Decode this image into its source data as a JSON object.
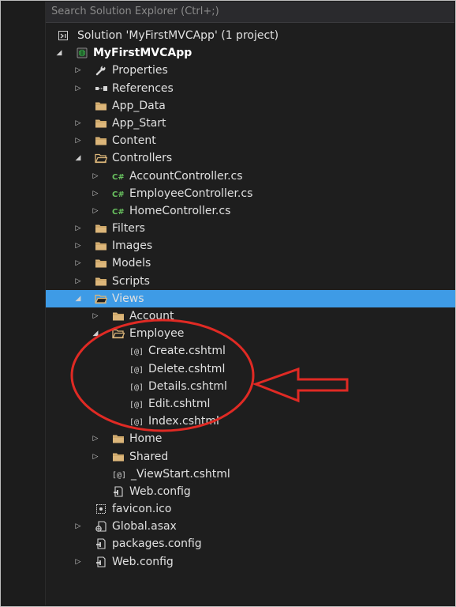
{
  "search": {
    "placeholder": "Search Solution Explorer (Ctrl+;)"
  },
  "tree": {
    "items": [
      {
        "label": "Solution 'MyFirstMVCApp' (1 project)",
        "level": 0,
        "arrow": "none",
        "icon": "solution-icon",
        "bold": false,
        "selected": false
      },
      {
        "label": "MyFirstMVCApp",
        "level": 0,
        "arrow": "expanded",
        "icon": "web-project-icon",
        "bold": true,
        "selected": false
      },
      {
        "label": "Properties",
        "level": 1,
        "arrow": "collapsed",
        "icon": "wrench-icon",
        "bold": false,
        "selected": false
      },
      {
        "label": "References",
        "level": 1,
        "arrow": "collapsed",
        "icon": "references-icon",
        "bold": false,
        "selected": false
      },
      {
        "label": "App_Data",
        "level": 1,
        "arrow": "none",
        "icon": "folder-icon",
        "bold": false,
        "selected": false
      },
      {
        "label": "App_Start",
        "level": 1,
        "arrow": "collapsed",
        "icon": "folder-icon",
        "bold": false,
        "selected": false
      },
      {
        "label": "Content",
        "level": 1,
        "arrow": "collapsed",
        "icon": "folder-icon",
        "bold": false,
        "selected": false
      },
      {
        "label": "Controllers",
        "level": 1,
        "arrow": "expanded",
        "icon": "folder-open-icon",
        "bold": false,
        "selected": false
      },
      {
        "label": "AccountController.cs",
        "level": 2,
        "arrow": "collapsed",
        "icon": "csharp-file-icon",
        "bold": false,
        "selected": false
      },
      {
        "label": "EmployeeController.cs",
        "level": 2,
        "arrow": "collapsed",
        "icon": "csharp-file-icon",
        "bold": false,
        "selected": false
      },
      {
        "label": "HomeController.cs",
        "level": 2,
        "arrow": "collapsed",
        "icon": "csharp-file-icon",
        "bold": false,
        "selected": false
      },
      {
        "label": "Filters",
        "level": 1,
        "arrow": "collapsed",
        "icon": "folder-icon",
        "bold": false,
        "selected": false
      },
      {
        "label": "Images",
        "level": 1,
        "arrow": "collapsed",
        "icon": "folder-icon",
        "bold": false,
        "selected": false
      },
      {
        "label": "Models",
        "level": 1,
        "arrow": "collapsed",
        "icon": "folder-icon",
        "bold": false,
        "selected": false
      },
      {
        "label": "Scripts",
        "level": 1,
        "arrow": "collapsed",
        "icon": "folder-icon",
        "bold": false,
        "selected": false
      },
      {
        "label": "Views",
        "level": 1,
        "arrow": "expanded",
        "icon": "folder-open-icon",
        "bold": false,
        "selected": true
      },
      {
        "label": "Account",
        "level": 2,
        "arrow": "collapsed",
        "icon": "folder-icon",
        "bold": false,
        "selected": false
      },
      {
        "label": "Employee",
        "level": 2,
        "arrow": "expanded",
        "icon": "folder-open-icon",
        "bold": false,
        "selected": false
      },
      {
        "label": "Create.cshtml",
        "level": 3,
        "arrow": "none",
        "icon": "razor-file-icon",
        "bold": false,
        "selected": false
      },
      {
        "label": "Delete.cshtml",
        "level": 3,
        "arrow": "none",
        "icon": "razor-file-icon",
        "bold": false,
        "selected": false
      },
      {
        "label": "Details.cshtml",
        "level": 3,
        "arrow": "none",
        "icon": "razor-file-icon",
        "bold": false,
        "selected": false
      },
      {
        "label": "Edit.cshtml",
        "level": 3,
        "arrow": "none",
        "icon": "razor-file-icon",
        "bold": false,
        "selected": false
      },
      {
        "label": "Index.cshtml",
        "level": 3,
        "arrow": "none",
        "icon": "razor-file-icon",
        "bold": false,
        "selected": false
      },
      {
        "label": "Home",
        "level": 2,
        "arrow": "collapsed",
        "icon": "folder-icon",
        "bold": false,
        "selected": false
      },
      {
        "label": "Shared",
        "level": 2,
        "arrow": "collapsed",
        "icon": "folder-icon",
        "bold": false,
        "selected": false
      },
      {
        "label": "_ViewStart.cshtml",
        "level": 2,
        "arrow": "none",
        "icon": "razor-file-icon",
        "bold": false,
        "selected": false
      },
      {
        "label": "Web.config",
        "level": 2,
        "arrow": "none",
        "icon": "config-file-icon",
        "bold": false,
        "selected": false
      },
      {
        "label": "favicon.ico",
        "level": 1,
        "arrow": "none",
        "icon": "image-file-icon",
        "bold": false,
        "selected": false
      },
      {
        "label": "Global.asax",
        "level": 1,
        "arrow": "collapsed",
        "icon": "global-asax-icon",
        "bold": false,
        "selected": false
      },
      {
        "label": "packages.config",
        "level": 1,
        "arrow": "none",
        "icon": "config-file-icon",
        "bold": false,
        "selected": false
      },
      {
        "label": "Web.config",
        "level": 1,
        "arrow": "collapsed",
        "icon": "config-file-icon",
        "bold": false,
        "selected": false
      }
    ]
  },
  "colors": {
    "background": "#1e1e1e",
    "selection": "#3e9be6",
    "folder": "#dcb67a",
    "csharp": "#68c15f",
    "annotation": "#e02a24"
  }
}
